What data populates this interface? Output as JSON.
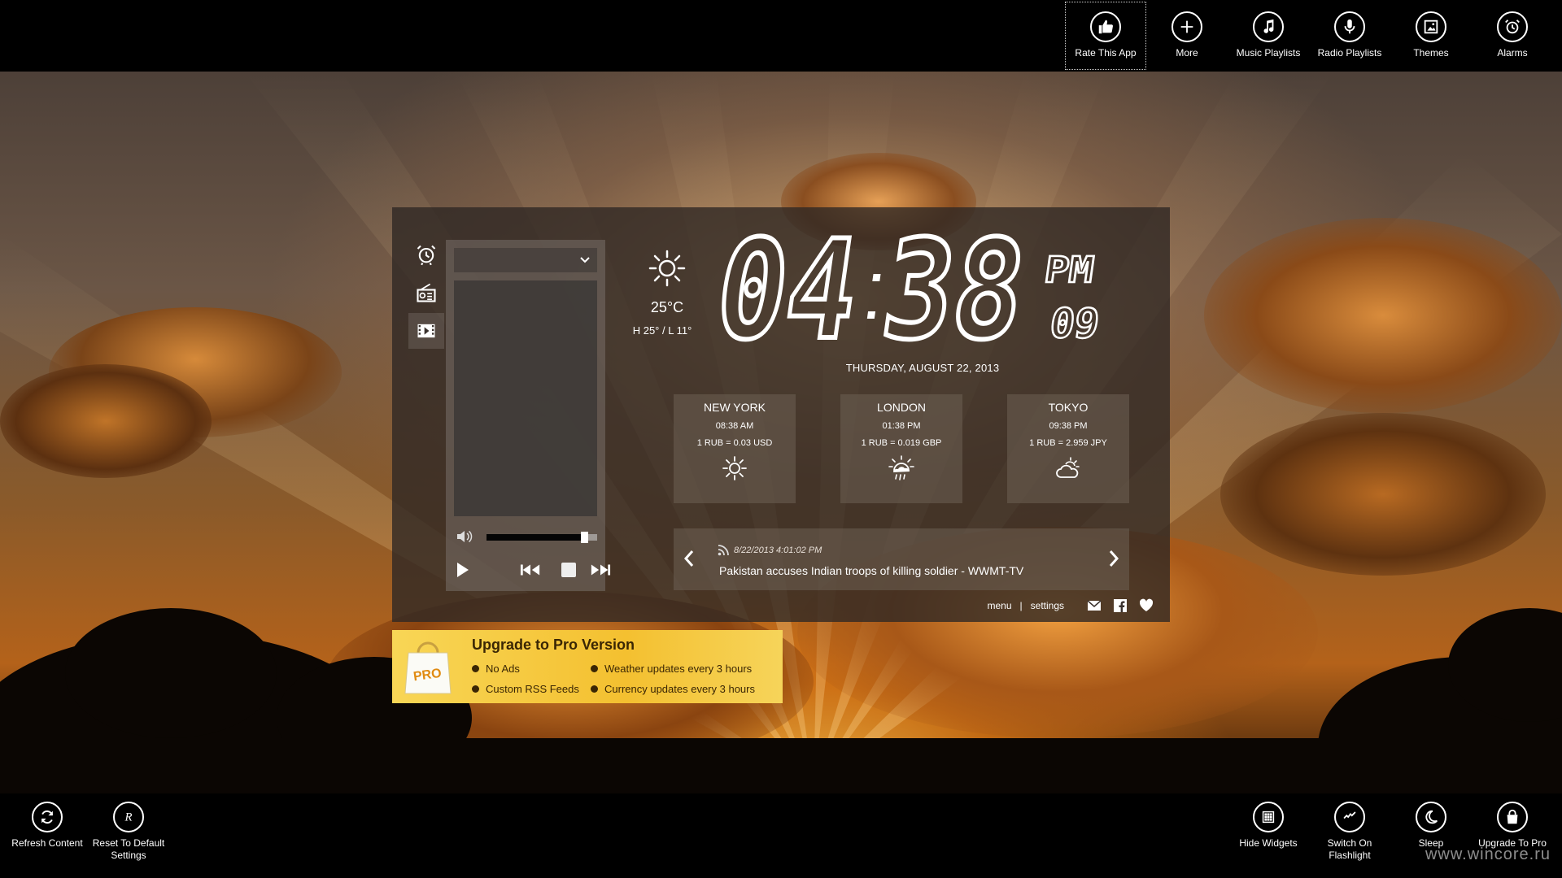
{
  "top_bar": {
    "commands": [
      {
        "label": "Rate This App",
        "icon": "thumbs-up-icon"
      },
      {
        "label": "More",
        "icon": "plus-icon"
      },
      {
        "label": "Music Playlists",
        "icon": "music-note-icon"
      },
      {
        "label": "Radio Playlists",
        "icon": "microphone-icon"
      },
      {
        "label": "Themes",
        "icon": "picture-icon"
      },
      {
        "label": "Alarms",
        "icon": "alarm-clock-icon"
      }
    ]
  },
  "bottom_bar": {
    "left": [
      {
        "label": "Refresh Content",
        "icon": "refresh-icon"
      },
      {
        "label": "Reset To Default Settings",
        "icon": "reset-icon"
      }
    ],
    "right": [
      {
        "label": "Hide Widgets",
        "icon": "widgets-icon"
      },
      {
        "label": "Switch On Flashlight",
        "icon": "flashlight-icon"
      },
      {
        "label": "Sleep",
        "icon": "moon-icon"
      },
      {
        "label": "Upgrade To Pro",
        "icon": "shopping-bag-icon"
      }
    ]
  },
  "side_tabs": [
    {
      "icon": "alarm-clock-icon",
      "active": false
    },
    {
      "icon": "radio-icon",
      "active": false
    },
    {
      "icon": "film-icon",
      "active": true
    }
  ],
  "player": {
    "dropdown_value": "",
    "volume_level": 0.88
  },
  "weather_now": {
    "icon": "sun-icon",
    "temperature": "25°C",
    "high_low": "H 25° / L 11°"
  },
  "clock": {
    "hours": "04",
    "minutes": "38",
    "seconds": "09",
    "ampm": "PM",
    "date": "THURSDAY, AUGUST 22, 2013"
  },
  "world_cities": [
    {
      "name": "NEW YORK",
      "time": "08:38 AM",
      "rate": "1 RUB = 0.03 USD",
      "icon": "sun-icon"
    },
    {
      "name": "LONDON",
      "time": "01:38 PM",
      "rate": "1 RUB = 0.019 GBP",
      "icon": "sun-rain-icon"
    },
    {
      "name": "TOKYO",
      "time": "09:38 PM",
      "rate": "1 RUB = 2.959 JPY",
      "icon": "cloud-sun-icon"
    }
  ],
  "news": {
    "timestamp": "8/22/2013 4:01:02 PM",
    "headline": "Pakistan accuses Indian troops of killing soldier - WWMT-TV"
  },
  "panel_links": {
    "menu": "menu",
    "separator": "|",
    "settings": "settings"
  },
  "promo": {
    "bag_text": "PRO",
    "title": "Upgrade to Pro Version",
    "features": [
      "No Ads",
      "Weather updates every 3 hours",
      "Custom RSS Feeds",
      "Currency updates every 3 hours"
    ]
  },
  "watermark": "www.wincore.ru",
  "colors": {
    "promo_yellow": "#f4c030",
    "panel_bg": "#302824",
    "bar_bg": "#000000"
  }
}
